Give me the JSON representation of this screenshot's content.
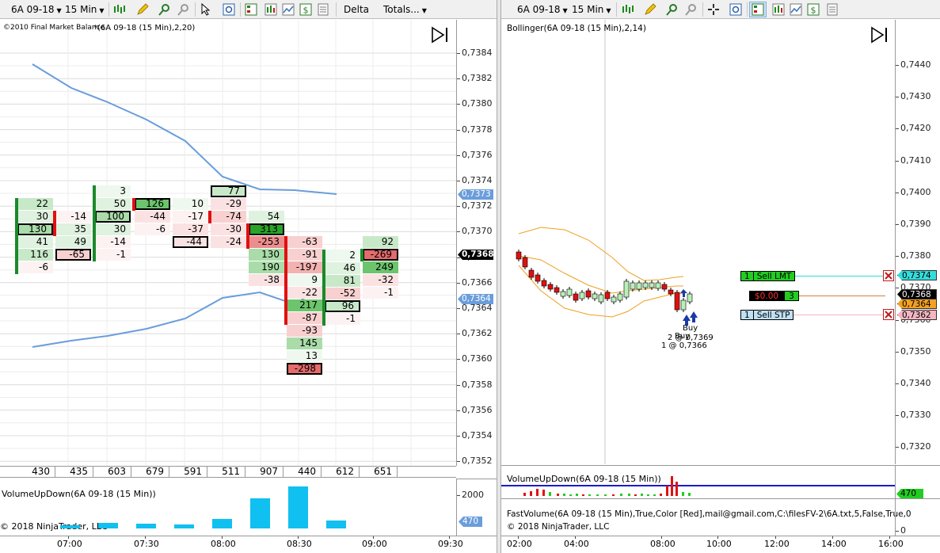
{
  "left_chart": {
    "toolbar": {
      "instrument": "6A 09-18",
      "interval": "15 Min",
      "mode": "Delta",
      "totals": "Totals..."
    },
    "indicator_label": "©2010 Final Market Balance",
    "series_label": "*(6A 09-18 (15 Min),2,20)",
    "price_axis": [
      "0,7384",
      "0,7382",
      "0,7380",
      "0,7378",
      "0,7376",
      "0,7374",
      "0,7372",
      "0,7370",
      "0,7368",
      "0,7366",
      "0,7364",
      "0,7362",
      "0,7360",
      "0,7358",
      "0,7356",
      "0,7354",
      "0,7352"
    ],
    "price_markers": [
      {
        "label": "0,7373",
        "color": "#6a9ddb"
      },
      {
        "label": "0,7368",
        "color": "#000000"
      },
      {
        "label": "0,7364",
        "color": "#6a9ddb"
      }
    ],
    "totals_row": [
      "430",
      "435",
      "603",
      "679",
      "591",
      "511",
      "907",
      "440",
      "612",
      "651"
    ],
    "volume_label": "VolumeUpDown(6A 09-18 (15 Min))",
    "volume_axis": [
      "2000"
    ],
    "volume_marker": "470",
    "copyright": "© 2018 NinjaTrader, LLC",
    "time_axis": [
      "07:00",
      "07:30",
      "08:00",
      "08:30",
      "09:00",
      "09:30"
    ],
    "footprint_bars": [
      {
        "cells": [
          {
            "v": "22",
            "c": "g2"
          },
          {
            "v": "30",
            "c": "g1"
          },
          {
            "v": "130",
            "c": "g3",
            "b": 1
          },
          {
            "v": "41",
            "c": "g1"
          },
          {
            "v": "116",
            "c": "g2"
          },
          {
            "v": "-6",
            "c": "r0"
          }
        ],
        "bar": "green"
      },
      {
        "cells": [
          {
            "v": "-14",
            "c": "r0"
          },
          {
            "v": "35",
            "c": "g1"
          },
          {
            "v": "49",
            "c": "g1"
          },
          {
            "v": "-65",
            "c": "r2",
            "b": 1
          }
        ],
        "bar": "red"
      },
      {
        "cells": [
          {
            "v": "3",
            "c": "g0"
          },
          {
            "v": "50",
            "c": "g1"
          },
          {
            "v": "100",
            "c": "g3",
            "b": 1
          },
          {
            "v": "30",
            "c": "g1"
          },
          {
            "v": "-14",
            "c": "r0"
          },
          {
            "v": "-1",
            "c": "r0"
          }
        ],
        "bar": "green"
      },
      {
        "cells": [
          {
            "v": "126",
            "c": "g4",
            "b": 1
          },
          {
            "v": "-44",
            "c": "r1"
          },
          {
            "v": "-6",
            "c": "r0"
          }
        ],
        "bar": "red"
      },
      {
        "cells": [
          {
            "v": "10",
            "c": "g0"
          },
          {
            "v": "-17",
            "c": "r0"
          },
          {
            "v": "-37",
            "c": "r1"
          },
          {
            "v": "-44",
            "c": "r1",
            "b": 1
          }
        ],
        "bar": ""
      },
      {
        "cells": [
          {
            "v": "77",
            "c": "g2",
            "b": 1
          },
          {
            "v": "-29",
            "c": "r1"
          },
          {
            "v": "-74",
            "c": "r2"
          },
          {
            "v": "-30",
            "c": "r1"
          },
          {
            "v": "-24",
            "c": "r1"
          }
        ],
        "bar": "red"
      },
      {
        "cells": [
          {
            "v": "54",
            "c": "g1"
          },
          {
            "v": "313",
            "c": "g5",
            "b": 1
          },
          {
            "v": "-253",
            "c": "r4"
          },
          {
            "v": "130",
            "c": "g3"
          },
          {
            "v": "190",
            "c": "g3"
          },
          {
            "v": "-38",
            "c": "r1"
          }
        ],
        "bar": "red"
      },
      {
        "cells": [
          {
            "v": "-63",
            "c": "r2"
          },
          {
            "v": "-91",
            "c": "r2"
          },
          {
            "v": "-197",
            "c": "r3"
          },
          {
            "v": "9",
            "c": "g0"
          },
          {
            "v": "-22",
            "c": "r1"
          },
          {
            "v": "217",
            "c": "g4"
          },
          {
            "v": "-87",
            "c": "r2"
          },
          {
            "v": "-93",
            "c": "r2"
          },
          {
            "v": "145",
            "c": "g3"
          },
          {
            "v": "13",
            "c": "g0"
          },
          {
            "v": "-298",
            "c": "r5",
            "b": 1
          }
        ],
        "bar": "red"
      },
      {
        "cells": [
          {
            "v": "2",
            "c": "g0"
          },
          {
            "v": "46",
            "c": "g1"
          },
          {
            "v": "81",
            "c": "g2"
          },
          {
            "v": "-52",
            "c": "r2"
          },
          {
            "v": "96",
            "c": "g2",
            "b": 1
          },
          {
            "v": "-1",
            "c": "r0"
          }
        ],
        "bar": "green"
      },
      {
        "cells": [
          {
            "v": "92",
            "c": "g2"
          },
          {
            "v": "-269",
            "c": "r5",
            "b": 1
          },
          {
            "v": "249",
            "c": "g4"
          },
          {
            "v": "-32",
            "c": "r1"
          },
          {
            "v": "-1",
            "c": "r0"
          }
        ],
        "bar": "green"
      }
    ]
  },
  "right_chart": {
    "toolbar": {
      "instrument": "6A 09-18",
      "interval": "15 Min"
    },
    "indicator_label": "Bollinger(6A 09-18 (15 Min),2,14)",
    "price_axis": [
      "0,7440",
      "0,7430",
      "0,7420",
      "0,7410",
      "0,7400",
      "0,7390",
      "0,7380",
      "0,7370",
      "0,7360",
      "0,7350",
      "0,7340",
      "0,7330",
      "0,7320"
    ],
    "price_markers": [
      {
        "label": "0,7374",
        "color": "#33dddd"
      },
      {
        "label": "0,7368",
        "color": "#000000"
      },
      {
        "label": "0,7364",
        "color": "#f4a020"
      },
      {
        "label": "0,7362",
        "color": "#f4b6c2"
      }
    ],
    "orders": [
      {
        "qty": "1",
        "label": "Sell LMT"
      },
      {
        "qty": "1",
        "label": "Sell STP"
      }
    ],
    "position": {
      "pnl": "$0.00",
      "qty": "3"
    },
    "trade_labels": [
      "Buy",
      "Buy",
      "2 @ 0,7369",
      "1 @ 0,7366"
    ],
    "volume_label": "VolumeUpDown(6A 09-18 (15 Min))",
    "volume_marker": "470",
    "fast_volume_label": "FastVolume(6A 09-18 (15 Min),True,Color [Red],mail@gmail.com,C:\\filesFV-2\\6A.txt,5,False,True,0",
    "copyright": "© 2018 NinjaTrader, LLC",
    "volume_axis": [
      "0"
    ],
    "time_axis": [
      "02:00",
      "04:00",
      "08:00",
      "10:00",
      "12:00",
      "14:00",
      "16:00"
    ]
  }
}
